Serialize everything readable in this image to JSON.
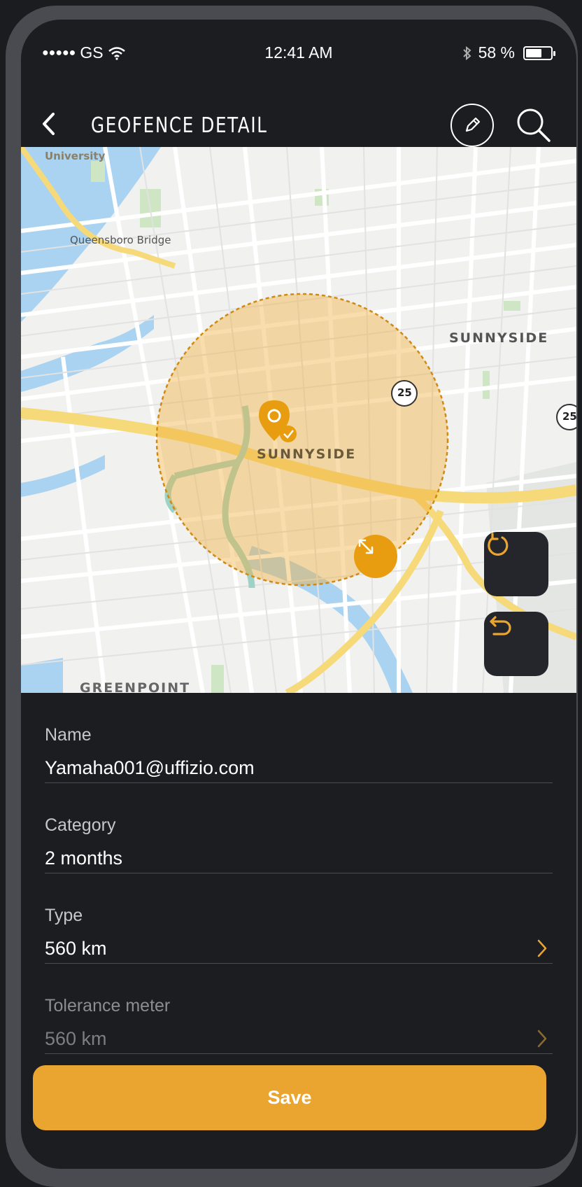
{
  "status_bar": {
    "signal": "●●●●●",
    "carrier": "GS",
    "time": "12:41 AM",
    "battery_text": "58 %",
    "battery_level": 0.58
  },
  "nav": {
    "title": "GEOFENCE DETAIL"
  },
  "map": {
    "labels": {
      "university": "University",
      "queensboro": "Queensboro Bridge",
      "sunnyside_right": "SUNNYSIDE",
      "sunnyside_center": "SUNNYSIDE",
      "greenpoint": "GREENPOINT",
      "route_25a": "25",
      "route_25b": "25"
    },
    "accent_color": "#eaa531"
  },
  "form": {
    "fields": [
      {
        "label": "Name",
        "value": "Yamaha001@uffizio.com"
      },
      {
        "label": "Category",
        "value": "2 months"
      },
      {
        "label": "Type",
        "value": "560 km"
      },
      {
        "label": "Tolerance meter",
        "value": "560 km"
      }
    ]
  },
  "save_label": "Save",
  "icons": {
    "back": "chevron-left-icon",
    "edit": "pencil-icon",
    "search": "search-icon",
    "rotate": "rotate-icon",
    "undo": "undo-icon",
    "resize": "resize-icon",
    "pin": "map-pin-icon"
  }
}
